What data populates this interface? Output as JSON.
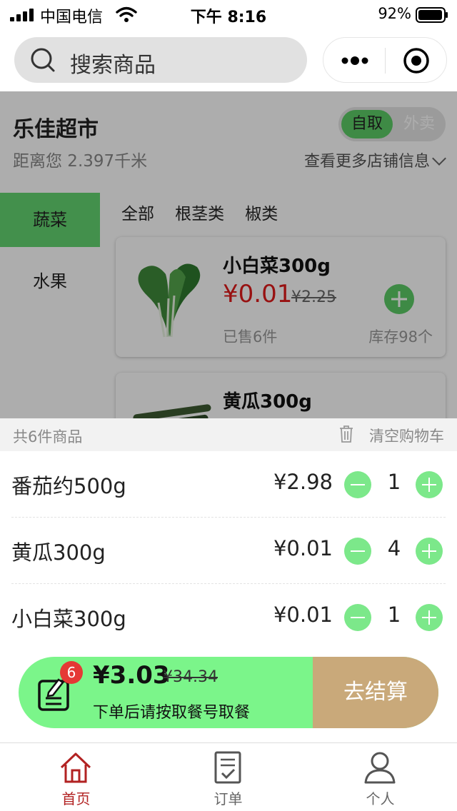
{
  "status_bar": {
    "carrier": "中国电信",
    "time": "下午 8:16",
    "battery": "92%"
  },
  "header": {
    "search_placeholder": "搜索商品"
  },
  "store": {
    "name": "乐佳超市",
    "distance": "距离您 2.397千米",
    "mode_pickup": "自取",
    "mode_delivery": "外卖",
    "more_info": "查看更多店铺信息"
  },
  "categories": {
    "active": "蔬菜",
    "items": [
      "水果"
    ],
    "subcategories": [
      "全部",
      "根茎类",
      "椒类"
    ]
  },
  "products": [
    {
      "name": "小白菜300g",
      "price": "¥0.01",
      "old_price": "¥2.25",
      "sold": "已售6件",
      "stock": "库存98个"
    },
    {
      "name": "黄瓜300g"
    }
  ],
  "cart": {
    "count_text": "共6件商品",
    "clear_text": "清空购物车",
    "items": [
      {
        "name": "番茄约500g",
        "price": "¥2.98",
        "qty": "1"
      },
      {
        "name": "黄瓜300g",
        "price": "¥0.01",
        "qty": "4"
      },
      {
        "name": "小白菜300g",
        "price": "¥0.01",
        "qty": "1"
      }
    ]
  },
  "checkout": {
    "badge": "6",
    "total": "¥3.03",
    "old_total": "¥34.34",
    "note": "下单后请按取餐号取餐",
    "button": "去结算"
  },
  "tabs": [
    {
      "label": "首页",
      "icon": "home-icon"
    },
    {
      "label": "订单",
      "icon": "order-icon"
    },
    {
      "label": "个人",
      "icon": "person-icon"
    }
  ],
  "colors": {
    "accent_green": "#5ccc66",
    "checkout_green": "#7bf58a",
    "checkout_button": "#c9a97a",
    "price_red": "#e01a1a",
    "active_tab": "#b22222"
  }
}
